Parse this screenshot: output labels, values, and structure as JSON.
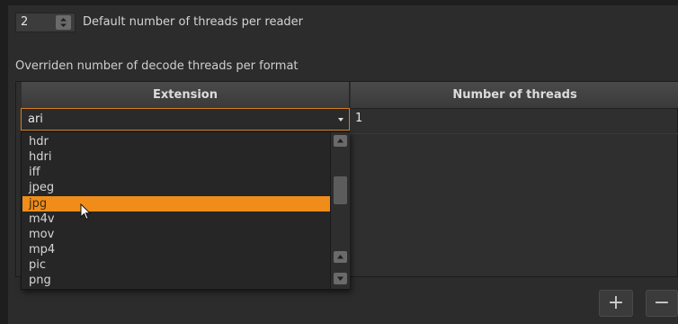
{
  "threads": {
    "value": "2",
    "label": "Default number of threads per reader"
  },
  "section": {
    "label": "Overriden number of decode threads per format"
  },
  "table": {
    "columns": [
      "Extension",
      "Number of threads"
    ],
    "row": {
      "extension": "ari",
      "threads": "1"
    }
  },
  "dropdown": {
    "options": [
      "hdr",
      "hdri",
      "iff",
      "jpeg",
      "jpg",
      "m4v",
      "mov",
      "mp4",
      "pic",
      "png"
    ],
    "selected": "jpg"
  },
  "buttons": {
    "add": "+",
    "remove": "−"
  },
  "colors": {
    "accent": "#f08d1a",
    "background": "#2c2c2c"
  },
  "icons": [
    "spin-arrows-icon",
    "chevron-down-icon",
    "scroll-up-icon",
    "scroll-down-icon",
    "mouse-cursor-icon"
  ]
}
